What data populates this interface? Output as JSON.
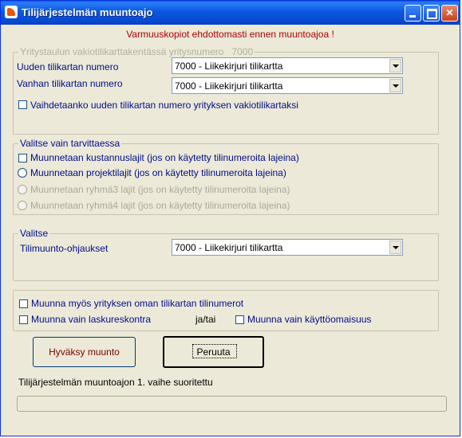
{
  "window": {
    "title": "Tilijärjestelmän muuntoajo",
    "minimize_icon": "minimize-icon",
    "maximize_icon": "maximize-icon",
    "close_icon": "close-icon",
    "close_glyph": "✕"
  },
  "warning": "Varmuuskopiot ehdottomasti ennen muuntoajoa !",
  "group1": {
    "legend": "Yritystaulun vakiotilikarttakentässä yritysnumero",
    "legend_value": "7000",
    "new_chart_label": "Uuden tilikartan numero",
    "new_chart_value": "7000 - Liikekirjuri tilikartta",
    "old_chart_label": "Vanhan tilikartan numero",
    "old_chart_value": "7000 - Liikekirjuri tilikartta",
    "swap_checkbox_label": "Vaihdetaanko uuden tilikartan numero yrityksen vakiotilikartaksi"
  },
  "group2": {
    "legend": "Valitse vain tarvittaessa",
    "options": [
      {
        "label": "Muunnetaan kustannuslajit (jos on käytetty tilinumeroita lajeina)"
      },
      {
        "label": "Muunnetaan projektilajit (jos on käytetty tilinumeroita lajeina)"
      },
      {
        "label": "Muunnetaan ryhmä3 lajit (jos on käytetty tilinumeroita lajeina)"
      },
      {
        "label": "Muunnetaan ryhmä4 lajit (jos on käytetty tilinumeroita lajeina)"
      }
    ]
  },
  "group3": {
    "legend": "Valitse",
    "controls_label": "Tilimuunto-ohjaukset",
    "controls_value": "7000 - Liikekirjuri tilikartta"
  },
  "group4": {
    "own_chart_label": "Muunna myös yrityksen oman tilikartan tilinumerot",
    "invoice_label": "Muunna vain laskureskontra",
    "andor_label": "ja/tai",
    "assets_label": "Muunna vain käyttöomaisuus"
  },
  "buttons": {
    "ok_label": "Hyväksy muunto",
    "cancel_label": "Peruuta"
  },
  "status": "Tilijärjestelmän muuntoajon 1. vaihe suoritettu",
  "progress": {
    "value": 0
  },
  "colors": {
    "accent": "#0a5ee6",
    "label": "#000d89",
    "warning": "#b00000"
  }
}
